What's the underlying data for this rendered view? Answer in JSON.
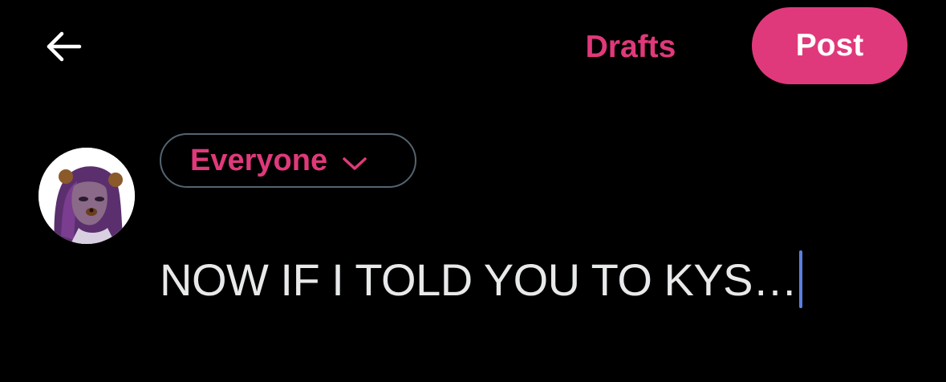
{
  "header": {
    "back_icon": "arrow-left-icon",
    "drafts_label": "Drafts",
    "post_label": "Post"
  },
  "composer": {
    "avatar_icon": "user-avatar",
    "audience_label": "Everyone",
    "audience_icon": "chevron-down-icon",
    "text": "NOW IF I TOLD YOU TO KYS…"
  },
  "colors": {
    "accent": "#e0397b",
    "background": "#000000",
    "text": "#e7e9ea",
    "caret": "#5b7fe0",
    "border": "#536471"
  }
}
